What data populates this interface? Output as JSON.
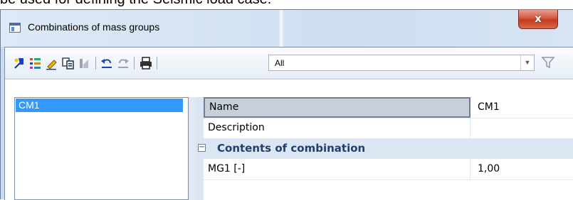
{
  "background_text": "be used for defining the Seismic load case.",
  "window": {
    "title": "Combinations of mass groups",
    "close_glyph": "x"
  },
  "toolbar": {
    "filter_value": "All",
    "buttons": [
      "new-icon",
      "properties-icon",
      "edit-icon",
      "copy-icon",
      "delete-icon",
      "undo-icon",
      "redo-icon",
      "print-icon"
    ]
  },
  "list": {
    "items": [
      "CM1"
    ],
    "selected": "CM1"
  },
  "properties": {
    "rows": [
      {
        "name": "Name",
        "value": "CM1"
      },
      {
        "name": "Description",
        "value": ""
      }
    ],
    "category": {
      "toggle": "⊟",
      "label": "Contents of combination"
    },
    "category_rows": [
      {
        "name": "MG1 [-]",
        "value": "1,00"
      }
    ]
  },
  "colors": {
    "selection": "#3399ff",
    "close_button": "#c43b1f",
    "category_text": "#1f3f73"
  }
}
